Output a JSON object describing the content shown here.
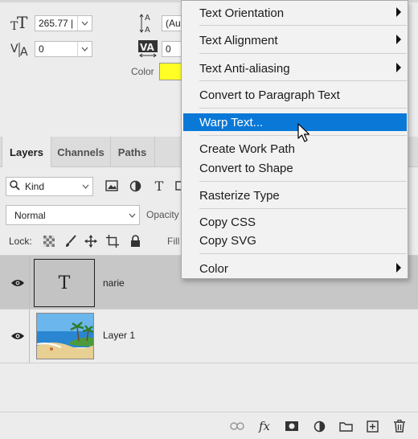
{
  "character": {
    "font_size_value": "265.77 |",
    "leading_value": "(Au",
    "kerning_value": "0",
    "tracking_value": "0",
    "color_label": "Color",
    "color_swatch": "#ffff26"
  },
  "layers_panel": {
    "tabs": [
      {
        "label": "Layers",
        "active": true
      },
      {
        "label": "Channels",
        "active": false
      },
      {
        "label": "Paths",
        "active": false
      }
    ],
    "filter_label": "Kind",
    "blend_mode": "Normal",
    "opacity_label": "Opacity",
    "lock_label": "Lock:",
    "fill_label": "Fill",
    "layers": [
      {
        "name": "narie",
        "thumb_glyph": "T",
        "selected": true
      },
      {
        "name": "Layer 1",
        "selected": false
      }
    ]
  },
  "context_menu": {
    "items": [
      {
        "label": "Text Orientation",
        "submenu": true
      },
      {
        "label": "Text Alignment",
        "submenu": true
      },
      {
        "label": "Text Anti-aliasing",
        "submenu": true
      },
      {
        "label": "Convert to Paragraph Text",
        "submenu": false
      },
      {
        "label": "Warp Text...",
        "submenu": false,
        "highlighted": true
      },
      {
        "label": "Create Work Path",
        "submenu": false
      },
      {
        "label": "Convert to Shape",
        "submenu": false
      },
      {
        "label": "Rasterize Type",
        "submenu": false
      },
      {
        "label": "Copy CSS",
        "submenu": false
      },
      {
        "label": "Copy SVG",
        "submenu": false
      },
      {
        "label": "Color",
        "submenu": true
      }
    ],
    "highlight_color": "#0a78d7"
  }
}
